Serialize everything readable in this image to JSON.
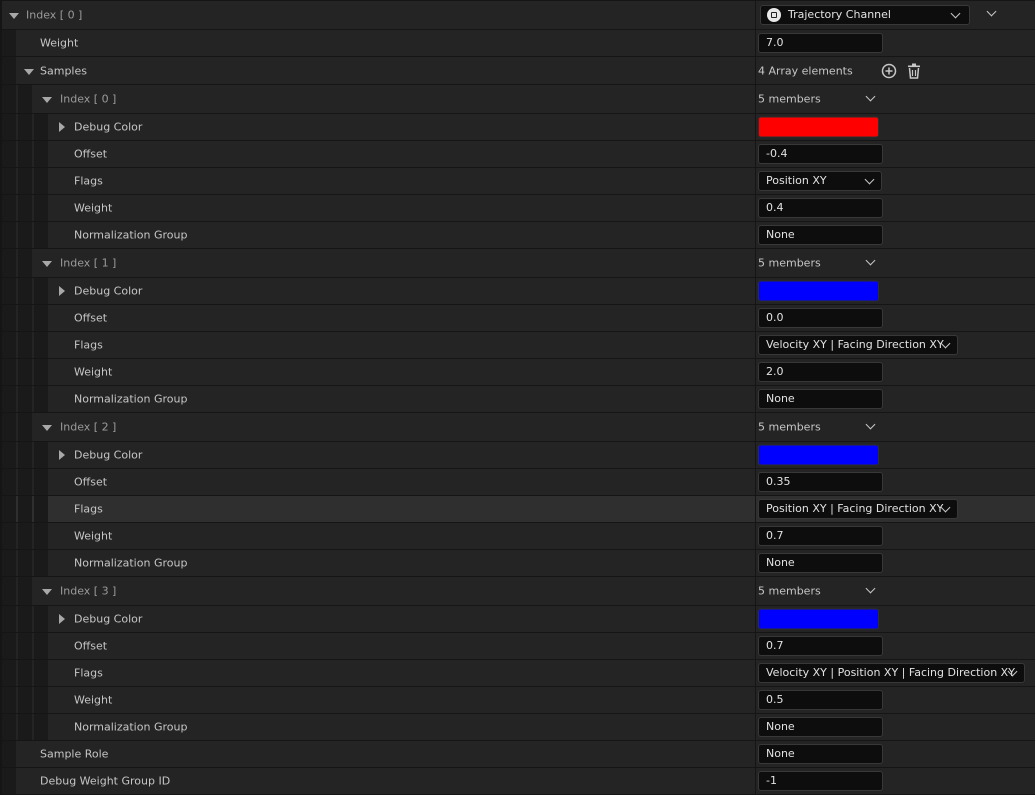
{
  "root": {
    "label": "Index [ 0 ]",
    "channel_label": "Trajectory Channel",
    "weight_label": "Weight",
    "weight_value": "7.0",
    "samples_label": "Samples",
    "samples_count": "4 Array elements",
    "sample_role_label": "Sample Role",
    "sample_role_value": "None",
    "debug_weight_group_label": "Debug Weight Group ID",
    "debug_weight_group_value": "-1"
  },
  "field_labels": {
    "debug_color": "Debug Color",
    "offset": "Offset",
    "flags": "Flags",
    "weight": "Weight",
    "normalization_group": "Normalization Group"
  },
  "samples": [
    {
      "label": "Index [ 0 ]",
      "members": "5 members",
      "color": "#ff0000",
      "offset": "-0.4",
      "flags": "Position XY",
      "weight": "0.4",
      "normalization_group": "None"
    },
    {
      "label": "Index [ 1 ]",
      "members": "5 members",
      "color": "#0000ff",
      "offset": "0.0",
      "flags": "Velocity XY | Facing Direction XY",
      "weight": "2.0",
      "normalization_group": "None"
    },
    {
      "label": "Index [ 2 ]",
      "members": "5 members",
      "color": "#0000ff",
      "offset": "0.35",
      "flags": "Position XY | Facing Direction XY",
      "weight": "0.7",
      "normalization_group": "None"
    },
    {
      "label": "Index [ 3 ]",
      "members": "5 members",
      "color": "#0000ff",
      "offset": "0.7",
      "flags": "Velocity XY | Position XY | Facing Direction XY",
      "weight": "0.5",
      "normalization_group": "None"
    }
  ]
}
